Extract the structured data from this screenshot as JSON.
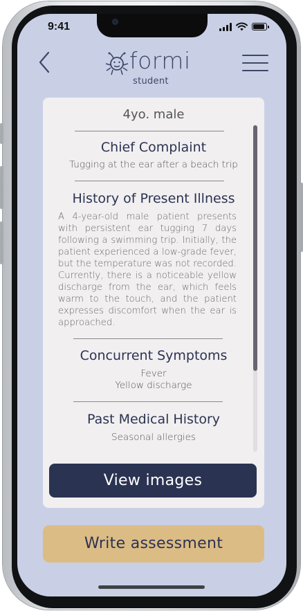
{
  "status_bar": {
    "time": "9:41",
    "icons": [
      "cellular-signal-icon",
      "wifi-icon",
      "battery-icon"
    ]
  },
  "header": {
    "back_icon": "chevron-left-icon",
    "logo_text": "formi",
    "logo_subtitle": "student",
    "menu_icon": "hamburger-menu-icon"
  },
  "case": {
    "patient": "4yo. male",
    "sections": [
      {
        "heading": "Chief Complaint",
        "body": [
          "Tugging at the ear after a beach trip"
        ]
      },
      {
        "heading": "History of Present Illness",
        "body": [
          "A 4-year-old male patient presents with persistent ear tugging 7 days following a swimming trip. Initially, the patient experienced a low-grade fever, but the temperature was not recorded. Currently, there is a noticeable yellow discharge from the ear, which feels warm to the touch, and the patient expresses discomfort when the ear is approached."
        ]
      },
      {
        "heading": "Concurrent Symptoms",
        "body": [
          "Fever",
          "Yellow discharge"
        ]
      },
      {
        "heading": "Past Medical History",
        "body": [
          "Seasonal allergies"
        ]
      }
    ],
    "view_images_label": "View images"
  },
  "write_assessment_label": "Write assessment",
  "colors": {
    "screen_bg": "#c9d0e6",
    "card_bg": "#f1eff0",
    "primary_navy": "#2b3352",
    "accent_gold": "#dcbc85"
  }
}
